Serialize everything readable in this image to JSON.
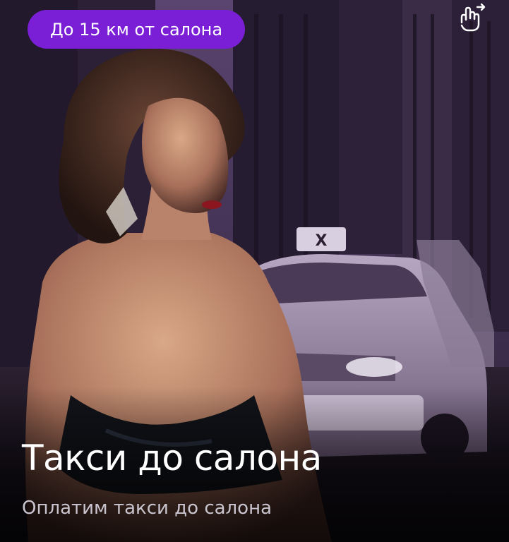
{
  "badge": {
    "label": "До 15 км от салона",
    "color": "#7a1fd6"
  },
  "hand_icon": "hand-swipe-icon",
  "title": "Такси до салона",
  "subtitle": "Оплатим такси до салона",
  "colors": {
    "accent": "#7a1fd6",
    "overlay_tint": "#3b2a47",
    "text_primary": "#ffffff",
    "text_secondary": "#c9c4ce"
  }
}
